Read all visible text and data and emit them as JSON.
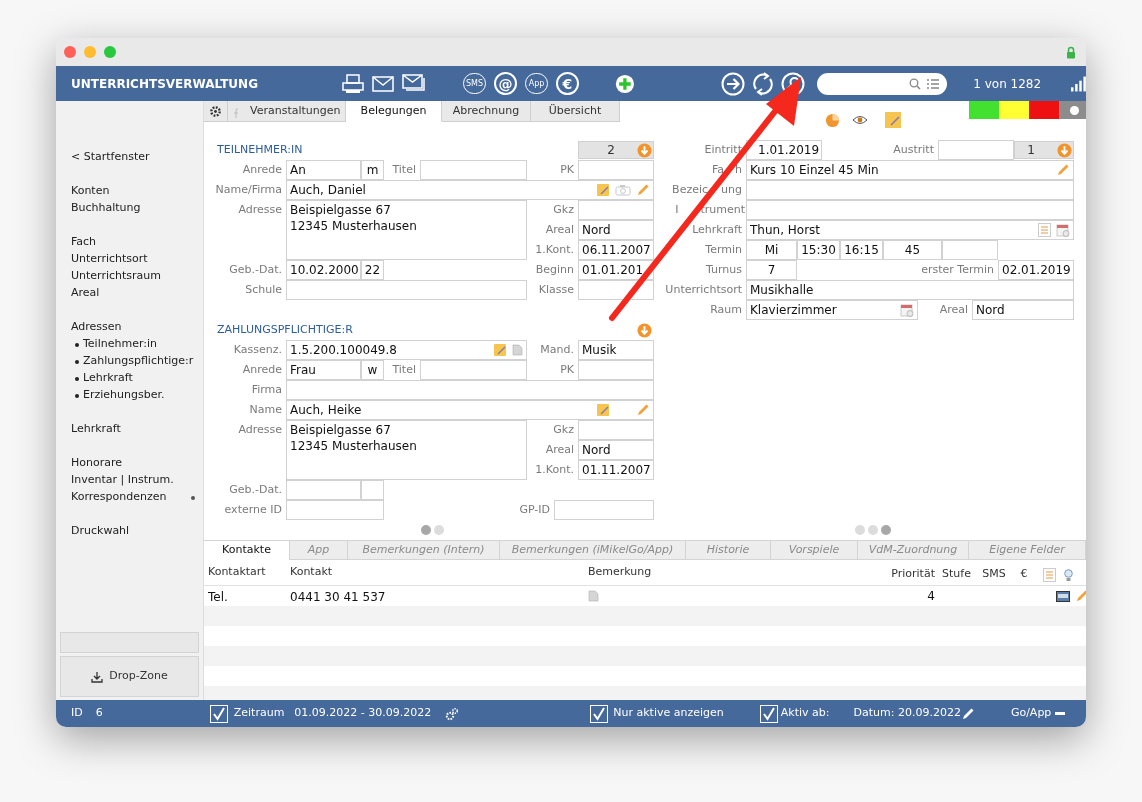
{
  "header": {
    "title": "UNTERRICHTSVERWALTUNG",
    "toolbar_glyphs": [
      "SMS",
      "@",
      "App",
      "€"
    ],
    "record_counter": "1 von 1282"
  },
  "tabs": [
    {
      "label": "Veranstaltungen",
      "selected": false
    },
    {
      "label": "Belegungen",
      "selected": true
    },
    {
      "label": "Abrechnung",
      "selected": false
    },
    {
      "label": "Übersicht",
      "selected": false
    }
  ],
  "status_lights": [
    {
      "color": "#42e02f"
    },
    {
      "color": "#ffff33"
    },
    {
      "color": "#ee1111"
    }
  ],
  "display_toggle": {
    "on": true
  },
  "sidebar": {
    "back_link": "< Startfenster",
    "groups": [
      [
        {
          "label": "Konten",
          "marked": false
        },
        {
          "label": "Buchhaltung",
          "marked": false
        }
      ],
      [
        {
          "label": "Fach",
          "marked": false
        },
        {
          "label": "Unterrichtsort",
          "marked": false
        },
        {
          "label": "Unterrichtsraum",
          "marked": false
        },
        {
          "label": "Areal",
          "marked": false
        }
      ],
      [
        {
          "label": "Adressen",
          "marked": false,
          "children": [
            {
              "label": "Teilnehmer:in",
              "marked": false
            },
            {
              "label": "Zahlungspflichtige:r",
              "marked": false
            },
            {
              "label": "Lehrkraft",
              "marked": false
            },
            {
              "label": "Erziehungsber.",
              "marked": false
            }
          ]
        }
      ],
      [
        {
          "label": "Lehrkraft",
          "marked": false
        }
      ],
      [
        {
          "label": "Honorare",
          "marked": false
        },
        {
          "label": "Inventar | Instrum.",
          "marked": false
        },
        {
          "label": "Korrespondenzen",
          "marked": true
        }
      ],
      [
        {
          "label": "Druckwahl",
          "marked": false
        }
      ]
    ],
    "drop_zone": "Drop-Zone"
  },
  "participant": {
    "heading": "TEILNEHMER:IN",
    "counter": "2",
    "anrede_label": "Anrede",
    "anrede": "An",
    "gender": "m",
    "titel_label": "Titel",
    "pk_label": "PK",
    "name_label": "Name/Firma",
    "name": "Auch, Daniel",
    "adresse_label": "Adresse",
    "adresse_lines": [
      "Beispielgasse 67",
      "12345 Musterhausen"
    ],
    "gkz_label": "Gkz",
    "areal_label": "Areal",
    "areal": "Nord",
    "kont_label": "1.Kont.",
    "kont": "06.11.2007",
    "geb_label": "Geb.-Dat.",
    "geb": "10.02.2000",
    "age": "22",
    "beginn_label": "Beginn",
    "beginn": "01.01.201",
    "schule_label": "Schule",
    "klasse_label": "Klasse"
  },
  "payer": {
    "heading": "ZAHLUNGSPFLICHTIGE:R",
    "kassenz_label": "Kassenz.",
    "kassenz": "1.5.200.100049.8",
    "mand_label": "Mand.",
    "mand": "Musik",
    "anrede_label": "Anrede",
    "anrede": "Frau",
    "gender": "w",
    "titel_label": "Titel",
    "pk_label": "PK",
    "firma_label": "Firma",
    "name_label": "Name",
    "name": "Auch, Heike",
    "adresse_label": "Adresse",
    "adresse_lines": [
      "Beispielgasse 67",
      "12345 Musterhausen"
    ],
    "gkz_label": "Gkz",
    "areal_label": "Areal",
    "areal": "Nord",
    "kont_label": "1.Kont.",
    "kont": "01.11.2007",
    "geb_label": "Geb.-Dat.",
    "extid_label": "externe ID",
    "gpid_label": "GP-ID"
  },
  "left_pages": [
    {
      "selected": true
    },
    {
      "selected": false
    }
  ],
  "booking": {
    "eintritt_label": "Eintritt",
    "eintritt": "1.01.2019",
    "austritt_label": "Austritt",
    "counter": "1",
    "fach_label": [
      "Fa",
      "h"
    ],
    "fach": "Kurs 10 Einzel 45 Min",
    "bezeichnung_label": [
      "Bezeic",
      "ung"
    ],
    "instrument_label": [
      "I",
      "trument"
    ],
    "lehrkraft_label": "Lehrkraft",
    "lehrkraft": "Thun, Horst",
    "termin_label": "Termin",
    "termin": [
      "Mi",
      "15:30",
      "16:15",
      "45"
    ],
    "turnus_label": "Turnus",
    "turnus": "7",
    "erster_label": "erster Termin",
    "erster": "02.01.2019",
    "ort_label": "Unterrichtsort",
    "ort": "Musikhalle",
    "raum_label": "Raum",
    "raum": "Klavierzimmer",
    "areal_label": "Areal",
    "areal": "Nord"
  },
  "right_pages": [
    {
      "selected": false
    },
    {
      "selected": false
    },
    {
      "selected": true
    }
  ],
  "bottom_tabs": [
    {
      "label": "Kontakte",
      "selected": true
    },
    {
      "label": "App",
      "selected": false
    },
    {
      "label": "Bemerkungen (Intern)",
      "selected": false
    },
    {
      "label": "Bemerkungen (iMikelGo/App)",
      "selected": false
    },
    {
      "label": "Historie",
      "selected": false
    },
    {
      "label": "Vorspiele",
      "selected": false
    },
    {
      "label": "VdM-Zuordnung",
      "selected": false
    },
    {
      "label": "Eigene Felder",
      "selected": false
    }
  ],
  "contacts": {
    "columns": [
      "Kontaktart",
      "Kontakt",
      "Bemerkung",
      "Priorität",
      "Stufe",
      "SMS",
      "€"
    ],
    "rows": [
      {
        "type": "Tel.",
        "contact": "0441 30 41 537",
        "priority": "4"
      }
    ]
  },
  "status_bar": {
    "id_label": "ID",
    "id": "6",
    "period": {
      "checked": true,
      "label": "Zeitraum",
      "range": "01.09.2022 - 30.09.2022"
    },
    "only_active": {
      "checked": true,
      "label": "Nur aktive anzeigen"
    },
    "active_from": {
      "checked": true,
      "label": "Aktiv ab:"
    },
    "date": "Datum: 20.09.2022",
    "go_app": "Go/App"
  }
}
